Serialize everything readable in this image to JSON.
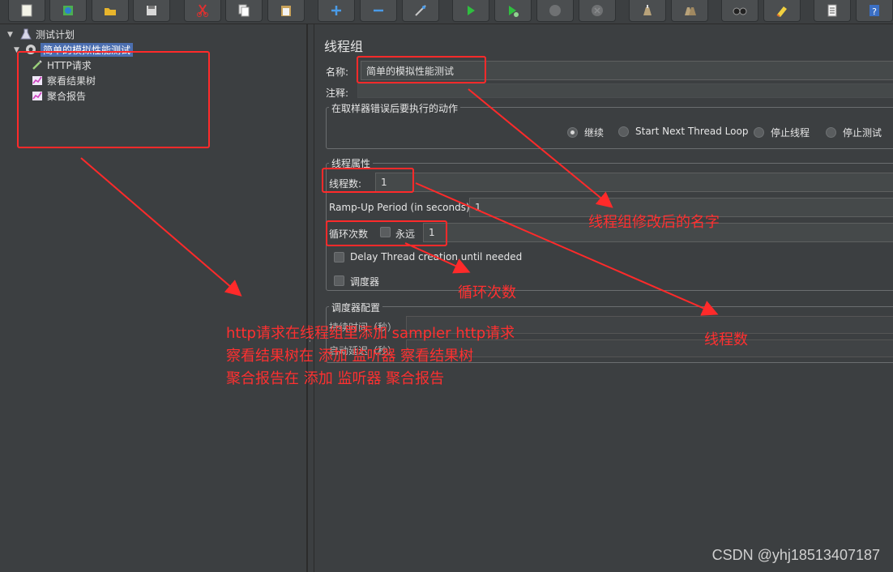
{
  "toolbar": {
    "buttons": [
      {
        "name": "new-icon"
      },
      {
        "name": "templates-icon"
      },
      {
        "name": "open-icon"
      },
      {
        "name": "save-icon"
      },
      {
        "name": "cut-icon"
      },
      {
        "name": "copy-icon"
      },
      {
        "name": "paste-icon"
      },
      {
        "name": "expand-icon"
      },
      {
        "name": "collapse-icon"
      },
      {
        "name": "toggle-icon"
      },
      {
        "name": "start-icon"
      },
      {
        "name": "start-no-pause-icon"
      },
      {
        "name": "stop-icon"
      },
      {
        "name": "shutdown-icon"
      },
      {
        "name": "clear-icon"
      },
      {
        "name": "clear-all-icon"
      },
      {
        "name": "search-icon"
      },
      {
        "name": "reset-search-icon"
      },
      {
        "name": "function-helper-icon"
      },
      {
        "name": "help-icon"
      }
    ]
  },
  "tree": {
    "root": "测试计划",
    "thread_group": "简单的模拟性能测试",
    "children": [
      "HTTP请求",
      "察看结果树",
      "聚合报告"
    ]
  },
  "panel": {
    "title": "线程组",
    "name_label": "名称:",
    "name_value": "简单的模拟性能测试",
    "comment_label": "注释:",
    "error_action_title": "在取样器错误后要执行的动作",
    "error_actions": [
      "继续",
      "Start Next Thread Loop",
      "停止线程",
      "停止测试"
    ],
    "thread_props_title": "线程属性",
    "threads_label": "线程数:",
    "threads_value": "1",
    "rampup_label": "Ramp-Up Period (in seconds):",
    "rampup_value": "1",
    "loop_label": "循环次数",
    "forever_label": "永远",
    "loop_value": "1",
    "delay_label": "Delay Thread creation until needed",
    "scheduler_label": "调度器",
    "scheduler_config_title": "调度器配置",
    "duration_label": "持续时间（秒）",
    "startup_delay_label": "启动延迟（秒）"
  },
  "annotations": {
    "thread_group_name": "线程组修改后的名字",
    "loop_count": "循环次数",
    "thread_count": "线程数",
    "instructions": [
      "http请求在线程组里添加   sampler    http请求",
      "察看结果树在   添加   监听器   察看结果树",
      "聚合报告在   添加   监听器   聚合报告"
    ],
    "color": "#ff2a2a"
  },
  "watermark": "CSDN @yhj18513407187"
}
